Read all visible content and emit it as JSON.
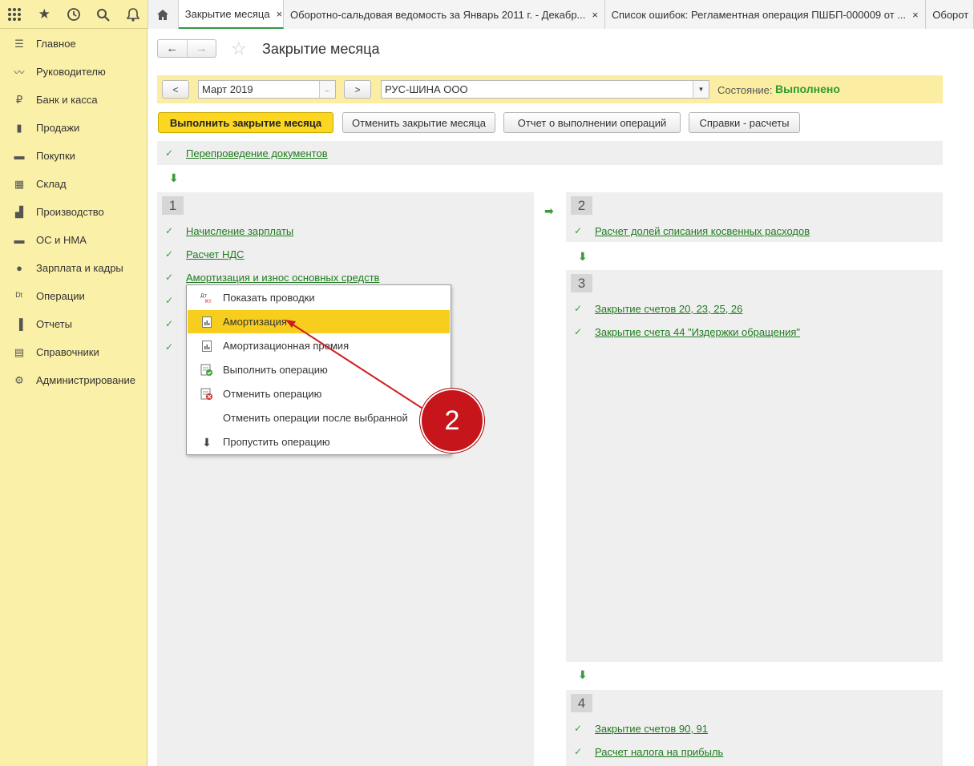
{
  "topbar": {
    "icons": [
      "apps-grid-icon",
      "star-icon",
      "history-icon",
      "search-icon",
      "bell-icon"
    ],
    "home_icon": "home-icon",
    "tabs": [
      {
        "label": "Закрытие месяца",
        "close": "×"
      },
      {
        "label": "Оборотно-сальдовая ведомость за Январь 2011 г. - Декабр...",
        "close": "×"
      },
      {
        "label": "Список ошибок: Регламентная операция ПШБП-000009 от ...",
        "close": "×"
      },
      {
        "label": "Оборот",
        "close": ""
      }
    ]
  },
  "sidebar": {
    "items": [
      {
        "label": "Главное",
        "icon": "menu-lines-icon",
        "glyph": "☰"
      },
      {
        "label": "Руководителю",
        "icon": "trend-chart-icon",
        "glyph": "〰"
      },
      {
        "label": "Банк и касса",
        "icon": "ruble-coin-icon",
        "glyph": "₽"
      },
      {
        "label": "Продажи",
        "icon": "shopping-bag-icon",
        "glyph": "▮"
      },
      {
        "label": "Покупки",
        "icon": "cart-icon",
        "glyph": "▬"
      },
      {
        "label": "Склад",
        "icon": "warehouse-grid-icon",
        "glyph": "▦"
      },
      {
        "label": "Производство",
        "icon": "factory-icon",
        "glyph": "▟"
      },
      {
        "label": "ОС и НМА",
        "icon": "truck-icon",
        "glyph": "▬"
      },
      {
        "label": "Зарплата и кадры",
        "icon": "person-icon",
        "glyph": "●"
      },
      {
        "label": "Операции",
        "icon": "dt-kt-icon",
        "glyph": "ᴰᵗ"
      },
      {
        "label": "Отчеты",
        "icon": "bar-chart-icon",
        "glyph": "▐"
      },
      {
        "label": "Справочники",
        "icon": "books-icon",
        "glyph": "▤"
      },
      {
        "label": "Администрирование",
        "icon": "gear-icon",
        "glyph": "⚙"
      }
    ]
  },
  "header": {
    "back_icon": "arrow-left-icon",
    "forward_icon": "arrow-right-icon",
    "back_glyph": "←",
    "forward_glyph": "→",
    "star_glyph": "☆",
    "title": "Закрытие месяца"
  },
  "period": {
    "prev": "<",
    "next": ">",
    "month": "Март 2019",
    "month_select": "...",
    "organization": "РУС-ШИНА ООО",
    "state_label": "Состояние:",
    "state_value": "Выполнено",
    "state_color": "#2e9a2e"
  },
  "actions": {
    "run": "Выполнить закрытие месяца",
    "cancel": "Отменить закрытие месяца",
    "report": "Отчет о выполнении операций",
    "help": "Справки - расчеты"
  },
  "stages": {
    "pre": {
      "label": "Перепроведение документов"
    },
    "stage1": {
      "number": "1",
      "items": [
        "Начисление зарплаты",
        "Расчет НДС",
        "Амортизация и износ основных средств"
      ]
    },
    "stage2": {
      "number": "2",
      "items": [
        "Расчет долей списания косвенных расходов"
      ]
    },
    "stage3": {
      "number": "3",
      "items": [
        "Закрытие счетов 20, 23, 25, 26",
        "Закрытие счета 44 \"Издержки обращения\""
      ]
    },
    "stage4": {
      "number": "4",
      "items": [
        "Закрытие счетов 90, 91",
        "Расчет налога на прибыль"
      ]
    }
  },
  "context_menu": {
    "items": [
      {
        "label": "Показать проводки",
        "icon": "dt-kt-icon"
      },
      {
        "label": "Амортизация",
        "icon": "report-icon"
      },
      {
        "label": "Амортизационная премия",
        "icon": "report-icon"
      },
      {
        "label": "Выполнить операцию",
        "icon": "run-operation-icon"
      },
      {
        "label": "Отменить операцию",
        "icon": "cancel-operation-icon"
      },
      {
        "label": "Отменить операции после выбранной",
        "icon": ""
      },
      {
        "label": "Пропустить операцию",
        "icon": "arrow-down-icon"
      }
    ]
  },
  "annotation": {
    "badge": "2",
    "color": "#c7151c"
  }
}
